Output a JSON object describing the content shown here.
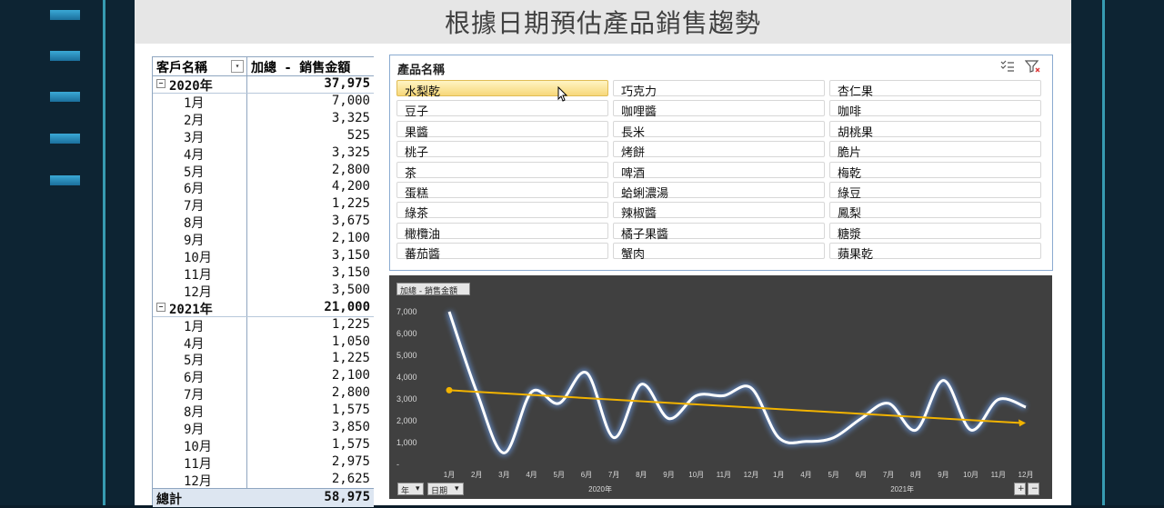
{
  "page_title": "根據日期預估產品銷售趨勢",
  "pivot": {
    "col_customer": "客戶名稱",
    "col_sum": "加總 - 銷售金額",
    "rows": [
      {
        "kind": "year",
        "label": "2020年",
        "value": "37,975"
      },
      {
        "kind": "month",
        "label": "1月",
        "value": "7,000"
      },
      {
        "kind": "month",
        "label": "2月",
        "value": "3,325"
      },
      {
        "kind": "month",
        "label": "3月",
        "value": "525"
      },
      {
        "kind": "month",
        "label": "4月",
        "value": "3,325"
      },
      {
        "kind": "month",
        "label": "5月",
        "value": "2,800"
      },
      {
        "kind": "month",
        "label": "6月",
        "value": "4,200"
      },
      {
        "kind": "month",
        "label": "7月",
        "value": "1,225"
      },
      {
        "kind": "month",
        "label": "8月",
        "value": "3,675"
      },
      {
        "kind": "month",
        "label": "9月",
        "value": "2,100"
      },
      {
        "kind": "month",
        "label": "10月",
        "value": "3,150"
      },
      {
        "kind": "month",
        "label": "11月",
        "value": "3,150"
      },
      {
        "kind": "month",
        "label": "12月",
        "value": "3,500"
      },
      {
        "kind": "year",
        "label": "2021年",
        "value": "21,000"
      },
      {
        "kind": "month",
        "label": "1月",
        "value": "1,225"
      },
      {
        "kind": "month",
        "label": "4月",
        "value": "1,050"
      },
      {
        "kind": "month",
        "label": "5月",
        "value": "1,225"
      },
      {
        "kind": "month",
        "label": "6月",
        "value": "2,100"
      },
      {
        "kind": "month",
        "label": "7月",
        "value": "2,800"
      },
      {
        "kind": "month",
        "label": "8月",
        "value": "1,575"
      },
      {
        "kind": "month",
        "label": "9月",
        "value": "3,850"
      },
      {
        "kind": "month",
        "label": "10月",
        "value": "1,575"
      },
      {
        "kind": "month",
        "label": "11月",
        "value": "2,975"
      },
      {
        "kind": "month",
        "label": "12月",
        "value": "2,625"
      }
    ],
    "total_label": "總計",
    "total_value": "58,975"
  },
  "slicer": {
    "title": "產品名稱",
    "items": [
      "水梨乾",
      "巧克力",
      "杏仁果",
      "豆子",
      "咖哩醬",
      "咖啡",
      "果醬",
      "長米",
      "胡桃果",
      "桃子",
      "烤餅",
      "脆片",
      "茶",
      "啤酒",
      "梅乾",
      "蛋糕",
      "蛤蜊濃湯",
      "綠豆",
      "綠茶",
      "辣椒醬",
      "鳳梨",
      "橄欖油",
      "橘子果醬",
      "糖漿",
      "蕃茄醬",
      "蟹肉",
      "蘋果乾"
    ],
    "selected": "水梨乾"
  },
  "chart_data": {
    "type": "line",
    "field_button": "加總 - 銷售金額",
    "x_month_labels": [
      "1月",
      "2月",
      "3月",
      "4月",
      "5月",
      "6月",
      "7月",
      "8月",
      "9月",
      "10月",
      "11月",
      "12月",
      "1月",
      "4月",
      "5月",
      "6月",
      "7月",
      "8月",
      "9月",
      "10月",
      "11月",
      "12月"
    ],
    "x_year_labels": [
      {
        "label": "2020年",
        "span": [
          0,
          11
        ]
      },
      {
        "label": "2021年",
        "span": [
          12,
          21
        ]
      }
    ],
    "values": [
      7000,
      3325,
      525,
      3325,
      2800,
      4200,
      1225,
      3675,
      2100,
      3150,
      3150,
      3500,
      1225,
      1050,
      1225,
      2100,
      2800,
      1575,
      3850,
      1575,
      2975,
      2625
    ],
    "trend": {
      "start": 3400,
      "end": 1900
    },
    "ylim": [
      0,
      7000
    ],
    "yticks": [
      0,
      1000,
      2000,
      3000,
      4000,
      5000,
      6000,
      7000
    ],
    "ytick_labels": [
      "-",
      "1,000",
      "2,000",
      "3,000",
      "4,000",
      "5,000",
      "6,000",
      "7,000"
    ],
    "colors": {
      "line": "#ffffff",
      "glow": "#6fa8ff",
      "trend": "#f2b300",
      "bg": "#404040"
    },
    "grid": false,
    "filter_buttons": [
      "年",
      "日期"
    ],
    "zoom_buttons": [
      "+",
      "−"
    ]
  }
}
